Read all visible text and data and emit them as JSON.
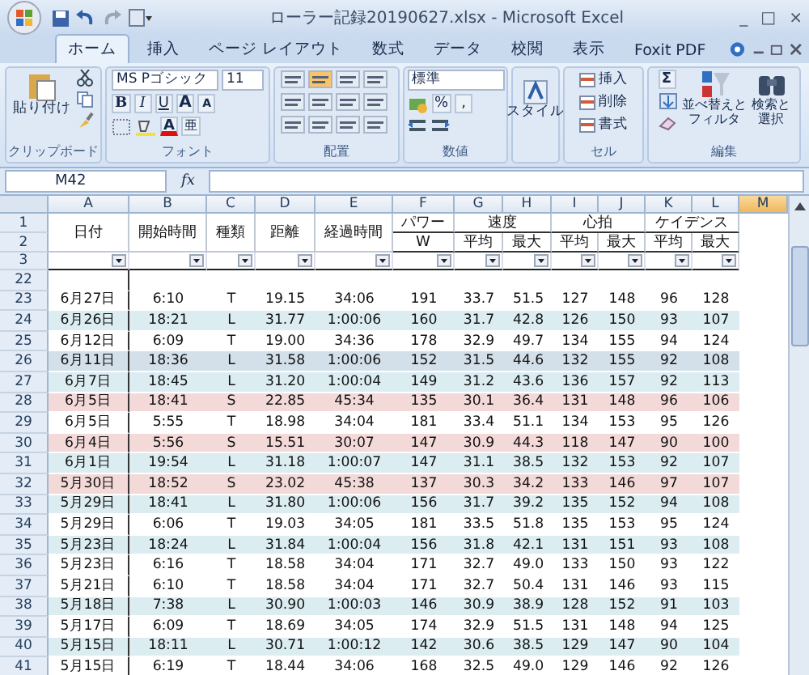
{
  "window": {
    "title": "ローラー記録20190627.xlsx - Microsoft Excel",
    "controls": [
      "_",
      "□",
      "×"
    ]
  },
  "tabs": [
    {
      "label": "ホーム",
      "selected": true
    },
    {
      "label": "挿入",
      "selected": false
    },
    {
      "label": "ページ レイアウト",
      "selected": false
    },
    {
      "label": "数式",
      "selected": false
    },
    {
      "label": "データ",
      "selected": false
    },
    {
      "label": "校閲",
      "selected": false
    },
    {
      "label": "表示",
      "selected": false
    },
    {
      "label": "Foxit PDF",
      "selected": false
    }
  ],
  "ribbon": {
    "clipboard": {
      "paste": "貼り付け",
      "label": "クリップボード"
    },
    "font": {
      "name": "MS Pゴシック",
      "size": "11",
      "styles": [
        "B",
        "I",
        "U"
      ],
      "grow": "A",
      "shrink": "A",
      "color_letter": "A",
      "phonetic": "亜",
      "label": "フォント"
    },
    "alignment": {
      "label": "配置"
    },
    "number": {
      "format": "標準",
      "percent": "%",
      "comma": ",",
      "label": "数値"
    },
    "styles": {
      "button": "スタイル"
    },
    "cells": {
      "items": [
        "挿入",
        "削除",
        "書式"
      ],
      "label": "セル"
    },
    "editing": {
      "sum": "Σ",
      "sort": [
        "並べ替えと",
        "フィルタ"
      ],
      "find": [
        "検索と",
        "選択"
      ],
      "label": "編集"
    }
  },
  "formula_bar": {
    "name_box": "M42",
    "fx": "fx"
  },
  "columns": [
    {
      "letter": "A",
      "selected": false
    },
    {
      "letter": "B",
      "selected": false
    },
    {
      "letter": "C",
      "selected": false
    },
    {
      "letter": "D",
      "selected": false
    },
    {
      "letter": "E",
      "selected": false
    },
    {
      "letter": "F",
      "selected": false
    },
    {
      "letter": "G",
      "selected": false
    },
    {
      "letter": "H",
      "selected": false
    },
    {
      "letter": "I",
      "selected": false
    },
    {
      "letter": "J",
      "selected": false
    },
    {
      "letter": "K",
      "selected": false
    },
    {
      "letter": "L",
      "selected": false
    },
    {
      "letter": "M",
      "selected": true
    }
  ],
  "header": {
    "row_numbers": [
      "1",
      "2",
      "3"
    ],
    "single": [
      "日付",
      "開始時間",
      "種類",
      "距離",
      "経過時間"
    ],
    "power": "パワー",
    "power_unit": "W",
    "groups": [
      {
        "label": "速度",
        "sub": [
          "平均",
          "最大"
        ]
      },
      {
        "label": "心拍",
        "sub": [
          "平均",
          "最大"
        ]
      },
      {
        "label": "ケイデンス",
        "sub": [
          "平均",
          "最大"
        ]
      }
    ]
  },
  "rows": [
    {
      "number": "22",
      "color": "#ffffff",
      "cells": []
    },
    {
      "number": "23",
      "color": "#ffffff",
      "cells": [
        "6月27日",
        "6:10",
        "T",
        "19.15",
        "34:06",
        "191",
        "33.7",
        "51.5",
        "127",
        "148",
        "96",
        "128"
      ]
    },
    {
      "number": "24",
      "color": "#dcedf2",
      "cells": [
        "6月26日",
        "18:21",
        "L",
        "31.77",
        "1:00:06",
        "160",
        "31.7",
        "42.8",
        "126",
        "150",
        "93",
        "107"
      ]
    },
    {
      "number": "25",
      "color": "#ffffff",
      "cells": [
        "6月12日",
        "6:09",
        "T",
        "19.00",
        "34:36",
        "178",
        "32.9",
        "49.7",
        "134",
        "155",
        "94",
        "124"
      ]
    },
    {
      "number": "26",
      "color": "#d3e0ea",
      "cells": [
        "6月11日",
        "18:36",
        "L",
        "31.58",
        "1:00:06",
        "152",
        "31.5",
        "44.6",
        "132",
        "155",
        "92",
        "108"
      ]
    },
    {
      "number": "27",
      "color": "#dcedf2",
      "cells": [
        "6月7日",
        "18:45",
        "L",
        "31.20",
        "1:00:04",
        "149",
        "31.2",
        "43.6",
        "136",
        "157",
        "92",
        "113"
      ]
    },
    {
      "number": "28",
      "color": "#f4d9d9",
      "cells": [
        "6月5日",
        "18:41",
        "S",
        "22.85",
        "45:34",
        "135",
        "30.1",
        "36.4",
        "131",
        "148",
        "96",
        "106"
      ]
    },
    {
      "number": "29",
      "color": "#ffffff",
      "cells": [
        "6月5日",
        "5:55",
        "T",
        "18.98",
        "34:04",
        "181",
        "33.4",
        "51.1",
        "134",
        "153",
        "95",
        "126"
      ]
    },
    {
      "number": "30",
      "color": "#f4d9d9",
      "cells": [
        "6月4日",
        "5:56",
        "S",
        "15.51",
        "30:07",
        "147",
        "30.9",
        "44.3",
        "118",
        "147",
        "90",
        "100"
      ]
    },
    {
      "number": "31",
      "color": "#dcedf2",
      "cells": [
        "6月1日",
        "19:54",
        "L",
        "31.18",
        "1:00:07",
        "147",
        "31.1",
        "38.5",
        "132",
        "153",
        "92",
        "107"
      ]
    },
    {
      "number": "32",
      "color": "#f4d9d9",
      "cells": [
        "5月30日",
        "18:52",
        "S",
        "23.02",
        "45:38",
        "137",
        "30.3",
        "34.2",
        "133",
        "146",
        "97",
        "107"
      ]
    },
    {
      "number": "33",
      "color": "#dcedf2",
      "cells": [
        "5月29日",
        "18:41",
        "L",
        "31.80",
        "1:00:06",
        "156",
        "31.7",
        "39.2",
        "135",
        "152",
        "94",
        "108"
      ]
    },
    {
      "number": "34",
      "color": "#ffffff",
      "cells": [
        "5月29日",
        "6:06",
        "T",
        "19.03",
        "34:05",
        "181",
        "33.5",
        "51.8",
        "135",
        "153",
        "95",
        "124"
      ]
    },
    {
      "number": "35",
      "color": "#dcedf2",
      "cells": [
        "5月23日",
        "18:24",
        "L",
        "31.84",
        "1:00:04",
        "156",
        "31.8",
        "42.1",
        "131",
        "151",
        "93",
        "108"
      ]
    },
    {
      "number": "36",
      "color": "#ffffff",
      "cells": [
        "5月23日",
        "6:16",
        "T",
        "18.58",
        "34:04",
        "171",
        "32.7",
        "49.0",
        "133",
        "150",
        "93",
        "122"
      ]
    },
    {
      "number": "37",
      "color": "#ffffff",
      "cells": [
        "5月21日",
        "6:10",
        "T",
        "18.58",
        "34:04",
        "171",
        "32.7",
        "50.4",
        "131",
        "146",
        "93",
        "115"
      ]
    },
    {
      "number": "38",
      "color": "#dcedf2",
      "cells": [
        "5月18日",
        "7:38",
        "L",
        "30.90",
        "1:00:03",
        "146",
        "30.9",
        "38.9",
        "128",
        "152",
        "91",
        "103"
      ]
    },
    {
      "number": "39",
      "color": "#ffffff",
      "cells": [
        "5月17日",
        "6:09",
        "T",
        "18.69",
        "34:05",
        "174",
        "32.9",
        "51.5",
        "131",
        "148",
        "94",
        "125"
      ]
    },
    {
      "number": "40",
      "color": "#dcedf2",
      "cells": [
        "5月15日",
        "18:11",
        "L",
        "30.71",
        "1:00:12",
        "142",
        "30.6",
        "38.5",
        "129",
        "147",
        "90",
        "104"
      ]
    },
    {
      "number": "41",
      "color": "#ffffff",
      "cells": [
        "5月15日",
        "6:19",
        "T",
        "18.44",
        "34:06",
        "168",
        "32.5",
        "49.0",
        "129",
        "146",
        "92",
        "126"
      ]
    }
  ]
}
